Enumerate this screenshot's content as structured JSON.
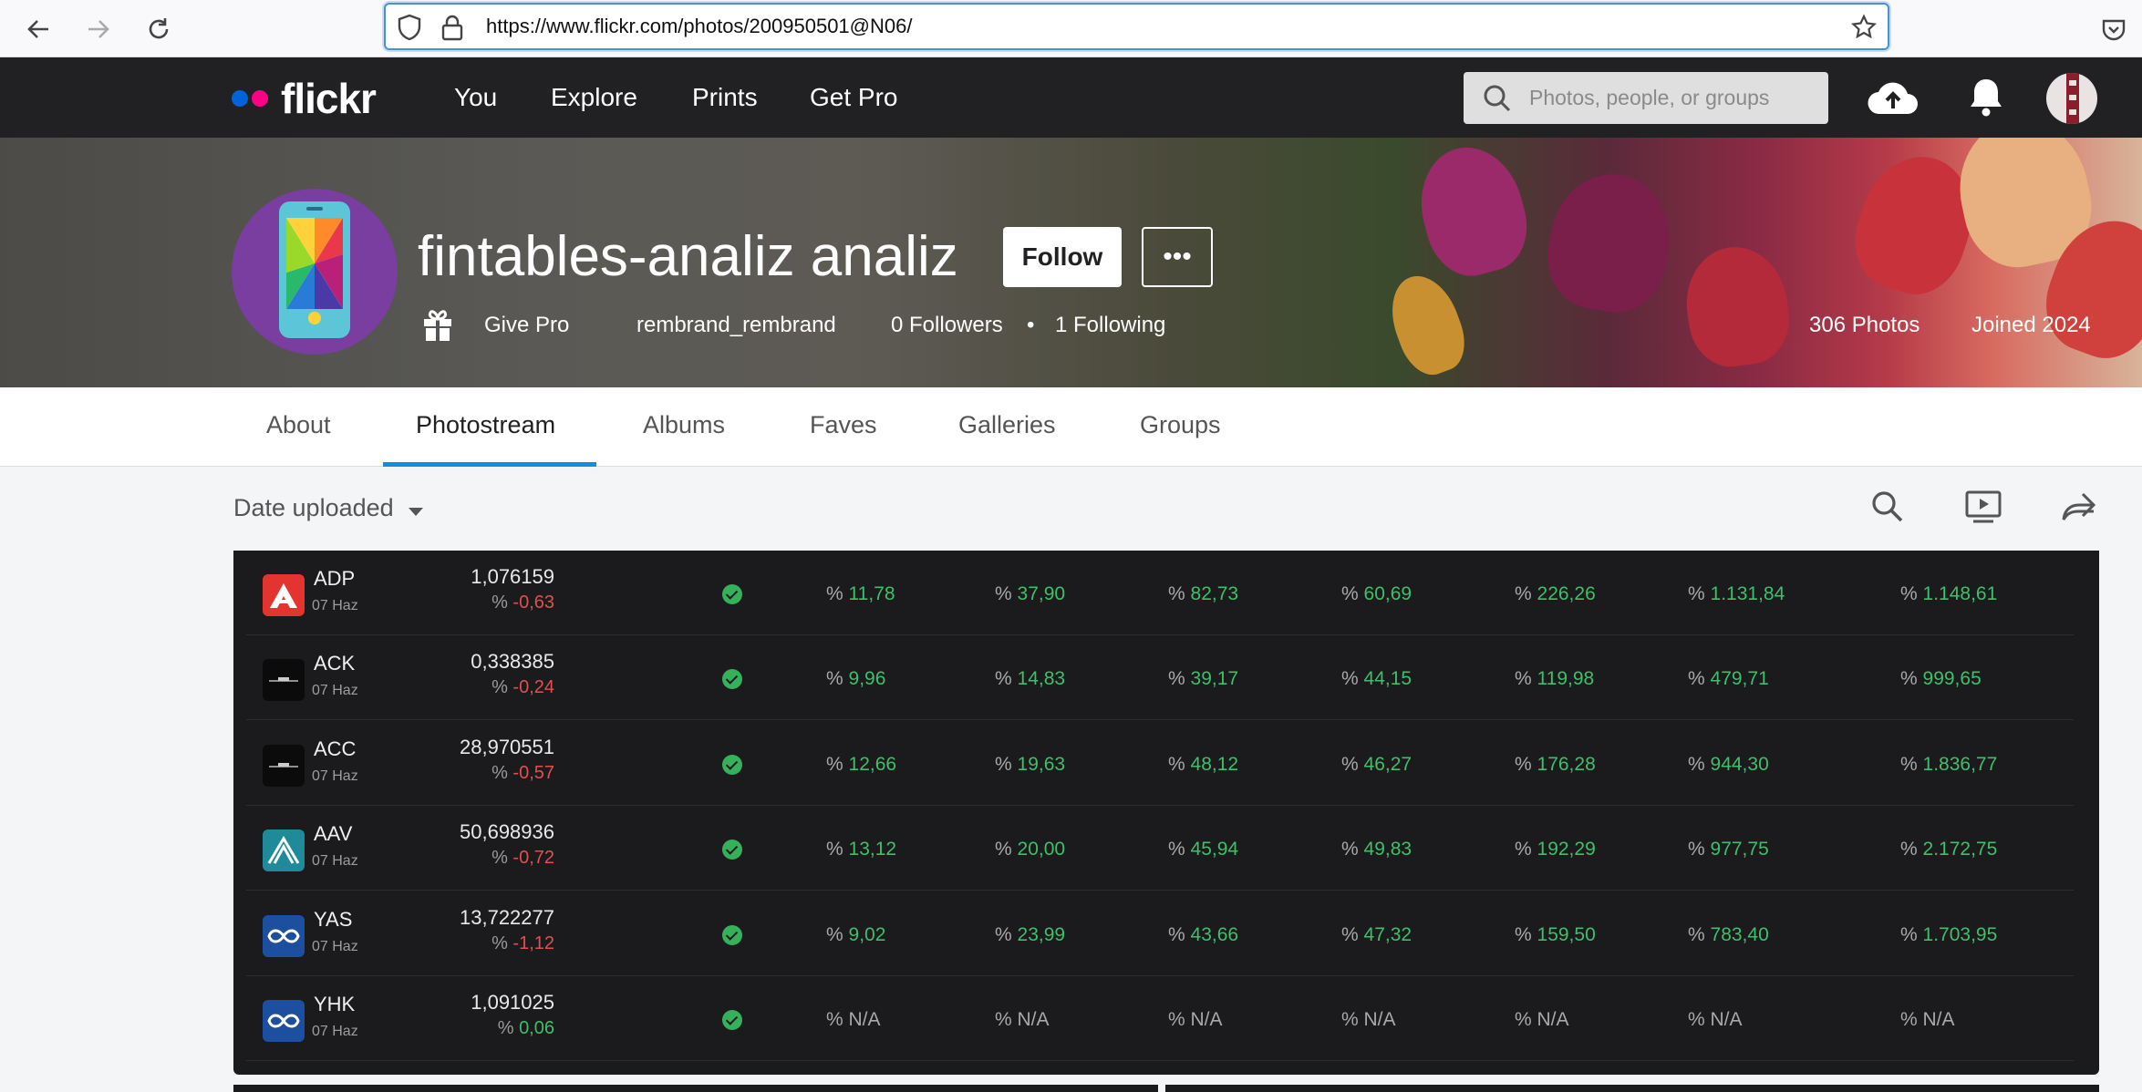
{
  "browser": {
    "url": "https://www.flickr.com/photos/200950501@N06/"
  },
  "header": {
    "logo_text": "flickr",
    "nav": [
      "You",
      "Explore",
      "Prints",
      "Get Pro"
    ],
    "search_placeholder": "Photos, people, or groups"
  },
  "profile": {
    "display_name": "fintables-analiz analiz",
    "follow_label": "Follow",
    "more_label": "•••",
    "give_pro": "Give Pro",
    "username": "rembrand_rembrand",
    "followers": "0 Followers",
    "following": "1 Following",
    "separator": "•",
    "photos": "306 Photos",
    "joined": "Joined 2024"
  },
  "tabs": [
    "About",
    "Photostream",
    "Albums",
    "Faves",
    "Galleries",
    "Groups"
  ],
  "active_tab": "Photostream",
  "toolbar": {
    "sort_label": "Date uploaded"
  },
  "table": {
    "rows": [
      {
        "ticker": "ADP",
        "date": "07 Haz",
        "price": "1,076159",
        "change": "-0,63",
        "change_positive": false,
        "logo": "red-a-logo",
        "cols": [
          "11,78",
          "37,90",
          "82,73",
          "60,69",
          "226,26",
          "1.131,84",
          "1.148,61"
        ]
      },
      {
        "ticker": "ACK",
        "date": "07 Haz",
        "price": "0,338385",
        "change": "-0,24",
        "change_positive": false,
        "logo": "black-logo",
        "cols": [
          "9,96",
          "14,83",
          "39,17",
          "44,15",
          "119,98",
          "479,71",
          "999,65"
        ]
      },
      {
        "ticker": "ACC",
        "date": "07 Haz",
        "price": "28,970551",
        "change": "-0,57",
        "change_positive": false,
        "logo": "black-logo",
        "cols": [
          "12,66",
          "19,63",
          "48,12",
          "46,27",
          "176,28",
          "944,30",
          "1.836,77"
        ]
      },
      {
        "ticker": "AAV",
        "date": "07 Haz",
        "price": "50,698936",
        "change": "-0,72",
        "change_positive": false,
        "logo": "teal-logo",
        "cols": [
          "13,12",
          "20,00",
          "45,94",
          "49,83",
          "192,29",
          "977,75",
          "2.172,75"
        ]
      },
      {
        "ticker": "YAS",
        "date": "07 Haz",
        "price": "13,722277",
        "change": "-1,12",
        "change_positive": false,
        "logo": "blue-logo",
        "cols": [
          "9,02",
          "23,99",
          "43,66",
          "47,32",
          "159,50",
          "783,40",
          "1.703,95"
        ]
      },
      {
        "ticker": "YHK",
        "date": "07 Haz",
        "price": "1,091025",
        "change": "0,06",
        "change_positive": true,
        "logo": "blue-logo",
        "cols": [
          "N/A",
          "N/A",
          "N/A",
          "N/A",
          "N/A",
          "N/A",
          "N/A"
        ]
      }
    ],
    "percent_sign": "%"
  },
  "colors": {
    "accent": "#128fdc",
    "positive": "#3fbf6a",
    "negative": "#e05050",
    "flickr_blue": "#0063dc",
    "flickr_pink": "#ff0084"
  }
}
